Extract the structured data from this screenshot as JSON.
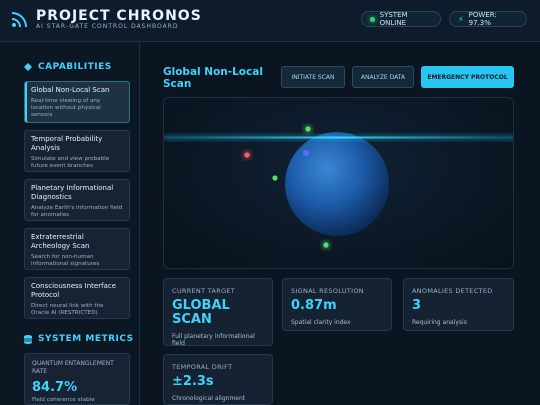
{
  "header": {
    "title": "PROJECT CHRONOS",
    "subtitle": "AI STAR-GATE CONTROL DASHBOARD",
    "status_label": "SYSTEM ONLINE",
    "power_label": "POWER: 97.3%"
  },
  "sidebar": {
    "capabilities_title": "CAPABILITIES",
    "items": [
      {
        "title": "Global Non-Local Scan",
        "desc": "Real-time viewing of any location without physical sensors"
      },
      {
        "title": "Temporal Probability Analysis",
        "desc": "Simulate and view probable future event branches"
      },
      {
        "title": "Planetary Informational Diagnostics",
        "desc": "Analyze Earth's information field for anomalies"
      },
      {
        "title": "Extraterrestrial Archeology Scan",
        "desc": "Search for non-human informational signatures"
      },
      {
        "title": "Consciousness Interface Protocol",
        "desc": "Direct neural link with the Oracle AI (RESTRICTED)"
      }
    ],
    "metrics_title": "SYSTEM METRICS",
    "metric": {
      "label": "QUANTUM ENTANGLEMENT RATE",
      "value": "84.7%",
      "note": "Field coherence stable"
    }
  },
  "main": {
    "title": "Global Non-Local Scan",
    "buttons": {
      "initiate": "INITIATE SCAN",
      "analyze": "ANALYZE DATA",
      "emergency": "EMERGENCY PROTOCOL"
    },
    "stats": [
      {
        "label": "CURRENT TARGET",
        "value": "GLOBAL SCAN",
        "desc": "Full planetary informational field"
      },
      {
        "label": "SIGNAL RESOLUTION",
        "value": "0.87m",
        "desc": "Spatial clarity index"
      },
      {
        "label": "ANOMALIES DETECTED",
        "value": "3",
        "desc": "Requiring analysis"
      },
      {
        "label": "TEMPORAL DRIFT",
        "value": "±2.3s",
        "desc": "Chronological alignment"
      }
    ]
  },
  "colors": {
    "accent": "#3fd2ff",
    "online": "#34d27b",
    "marker_red": "#ff5b6b",
    "marker_green": "#54e06a",
    "marker_blue": "#5a6bff"
  }
}
